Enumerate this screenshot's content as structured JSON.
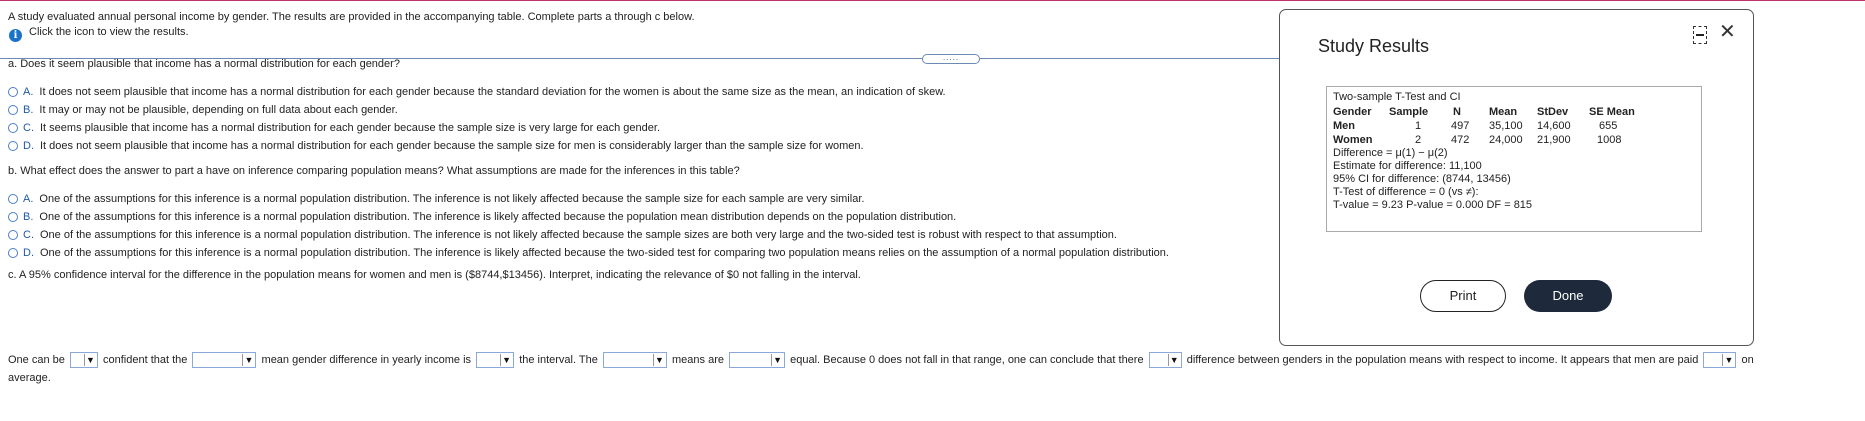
{
  "header": {
    "instructions": "A study evaluated annual personal income by gender. The results are provided in the accompanying table. Complete parts a through c below.",
    "info_link": "Click the icon to view the results.",
    "handle_label": "....."
  },
  "partA": {
    "question": "a. Does it seem plausible that income has a normal distribution for each gender?",
    "options": [
      {
        "letter": "A.",
        "text": "It does not seem plausible that income has a normal distribution for each gender because the standard deviation for the women is about the same size as the mean, an indication of skew."
      },
      {
        "letter": "B.",
        "text": "It may or may not be plausible, depending on full data about each gender."
      },
      {
        "letter": "C.",
        "text": "It seems plausible that income has a normal distribution for each gender because the sample size is very large for each gender."
      },
      {
        "letter": "D.",
        "text": "It does not seem plausible that income has a normal distribution for each gender because the sample size for men is considerably larger than the sample size for women."
      }
    ]
  },
  "partB": {
    "question": "b. What effect does the answer to part a have on inference comparing population means? What assumptions are made for the inferences in this table?",
    "options": [
      {
        "letter": "A.",
        "text": "One of the assumptions for this inference is a normal population distribution. The inference is not likely affected because the sample size for each sample are very similar."
      },
      {
        "letter": "B.",
        "text": "One of the assumptions for this inference is a normal population distribution. The inference is likely affected because the population mean distribution depends on the population distribution."
      },
      {
        "letter": "C.",
        "text": "One of the assumptions for this inference is a normal population distribution. The inference is not likely affected because the sample sizes are both very large and the two-sided test is robust with respect to that assumption."
      },
      {
        "letter": "D.",
        "text": "One of the assumptions for this inference is a normal population distribution. The inference is likely affected because the two-sided test for comparing two population means relies on the assumption of a normal population distribution."
      }
    ]
  },
  "partC": {
    "question": "c. A 95% confidence interval for the difference in the population means for women and men is ($8744,$13456). Interpret, indicating the relevance of $0 not falling in the interval.",
    "s1": "One can be",
    "s2": "confident that the",
    "s3": "mean gender difference in yearly income is",
    "s4": "the interval. The",
    "s5": "means are",
    "s6": "equal. Because 0 does not fall in that range, one can conclude that there",
    "s7": "difference between genders in the population means with respect to income. It appears that men are paid",
    "s8": "on",
    "s9": "average.",
    "dropdown_values": [
      "",
      "",
      "",
      "",
      "",
      "",
      ""
    ]
  },
  "dialog": {
    "title": "Study Results",
    "print_label": "Print",
    "done_label": "Done",
    "table": {
      "title": "Two-sample T-Test and CI",
      "headers": [
        "Gender",
        "Sample",
        "N",
        "Mean",
        "StDev",
        "SE Mean"
      ],
      "rows": [
        [
          "Men",
          "1",
          "497",
          "35,100",
          "14,600",
          "655"
        ],
        [
          "Women",
          "2",
          "472",
          "24,000",
          "21,900",
          "1008"
        ]
      ],
      "notes": [
        "Difference = μ(1) − μ(2)",
        "Estimate for difference: 11,100",
        "95% CI for difference: (8744, 13456)",
        "T-Test of difference = 0 (vs ≠):",
        "T-value = 9.23  P-value = 0.000  DF = 815"
      ]
    }
  }
}
